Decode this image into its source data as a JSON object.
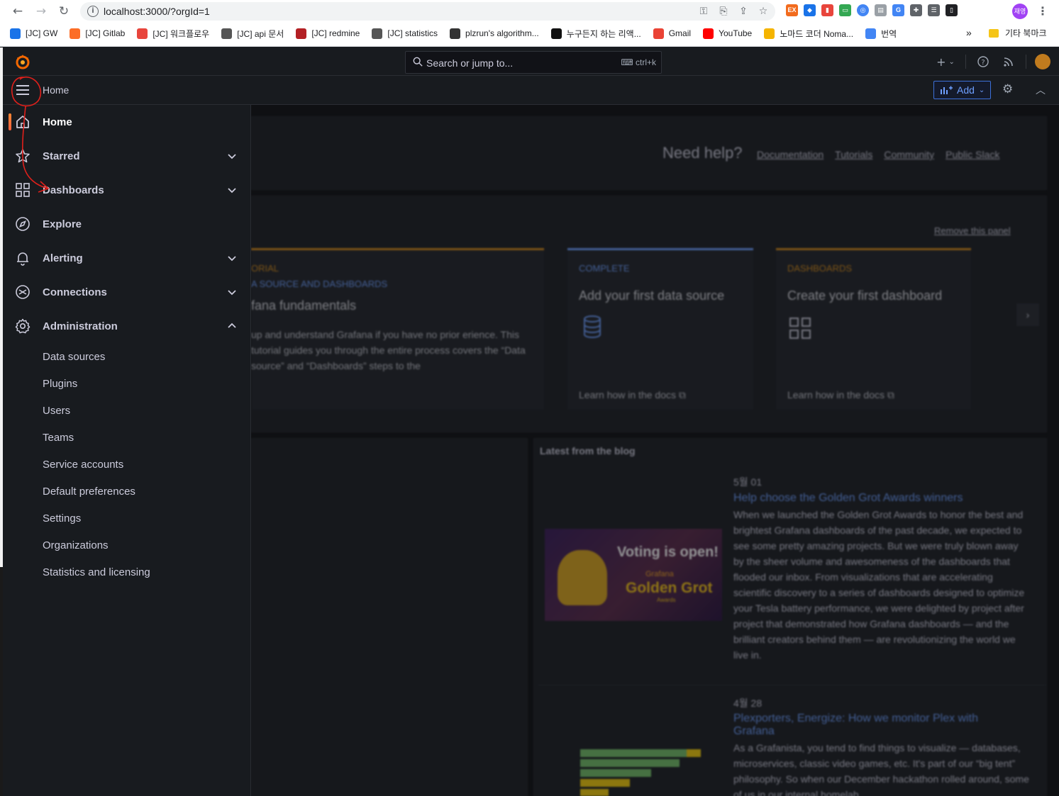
{
  "browser": {
    "url": "localhost:3000/?orgId=1",
    "profile_label": "재영",
    "bookmarks": [
      {
        "label": "[JC] GW",
        "color": "#1a73e8"
      },
      {
        "label": "[JC] Gitlab",
        "color": "#fc6d26"
      },
      {
        "label": "[JC] 워크플로우",
        "color": "#e8453c"
      },
      {
        "label": "[JC] api 문서",
        "color": "#555555"
      },
      {
        "label": "[JC] redmine",
        "color": "#b32024"
      },
      {
        "label": "[JC] statistics",
        "color": "#555555"
      },
      {
        "label": "plzrun's algorithm...",
        "color": "#333333"
      },
      {
        "label": "누구든지 하는 리액...",
        "color": "#111111"
      },
      {
        "label": "Gmail",
        "color": "#ea4335"
      },
      {
        "label": "YouTube",
        "color": "#ff0000"
      },
      {
        "label": "노마드 코더 Noma...",
        "color": "#f5b400"
      },
      {
        "label": "번역",
        "color": "#4285f4"
      }
    ],
    "bookmarks_more": "»",
    "other_bookmarks": "기타 북마크"
  },
  "topbar": {
    "search_placeholder": "Search or jump to...",
    "search_shortcut": "ctrl+k",
    "plus_label": "+",
    "help_icon": "help-icon",
    "news_icon": "rss-icon"
  },
  "subbar": {
    "breadcrumb": "Home",
    "add_label": "Add"
  },
  "sidenav": {
    "items": [
      {
        "label": "Home",
        "icon": "home-icon",
        "active": true
      },
      {
        "label": "Starred",
        "icon": "star-icon",
        "expandable": true
      },
      {
        "label": "Dashboards",
        "icon": "apps-icon",
        "expandable": true
      },
      {
        "label": "Explore",
        "icon": "compass-icon"
      },
      {
        "label": "Alerting",
        "icon": "bell-icon",
        "expandable": true
      },
      {
        "label": "Connections",
        "icon": "connections-icon",
        "expandable": true
      },
      {
        "label": "Administration",
        "icon": "cog-icon",
        "expanded": true
      }
    ],
    "admin_children": [
      "Data sources",
      "Plugins",
      "Users",
      "Teams",
      "Service accounts",
      "Default preferences",
      "Settings",
      "Organizations",
      "Statistics and licensing"
    ]
  },
  "dashboard": {
    "help_title": "Need help?",
    "help_links": [
      "Documentation",
      "Tutorials",
      "Community",
      "Public Slack"
    ],
    "remove_panel": "Remove this panel",
    "cards": [
      {
        "tag": "ORIAL",
        "tag2": "A SOURCE AND DASHBOARDS",
        "title": "fana fundamentals",
        "desc": "up and understand Grafana if you have no prior erience. This tutorial guides you through the entire process covers the “Data source” and “Dashboards” steps to the",
        "tag_color": "#d48a1a"
      },
      {
        "tag": "COMPLETE",
        "title": "Add your first data source",
        "learn": "Learn how in the docs",
        "tag_color": "#6e9fff"
      },
      {
        "tag": "DASHBOARDS",
        "title": "Create your first dashboard",
        "learn": "Learn how in the docs",
        "tag_color": "#d48a1a"
      }
    ],
    "next_arrow": "›",
    "blog_heading": "Latest from the blog",
    "blog_posts": [
      {
        "date": "5월 01",
        "title": "Help choose the Golden Grot Awards winners",
        "body": "When we launched the Golden Grot Awards to honor the best and brightest Grafana dashboards of the past decade, we expected to see some pretty amazing projects. But we were truly blown away by the sheer volume and awesomeness of the dashboards that flooded our inbox. From visualizations that are accelerating scientific discovery to a series of dashboards designed to optimize your Tesla battery performance, we were delighted by project after project that demonstrated how Grafana dashboards — and the brilliant creators behind them — are revolutionizing the world we live in."
      },
      {
        "date": "4월 28",
        "title": "Plexporters, Energize: How we monitor Plex with Grafana",
        "body": "As a Grafanista, you tend to find things to visualize — databases, microservices, classic video games, etc. It's part of our “big tent” philosophy. So when our December hackathon rolled around, some of us in our internal homelab"
      }
    ],
    "voting": {
      "headline": "Voting is open!",
      "brand": "Grafana",
      "award": "Golden Grot",
      "award_sub": "Awards"
    }
  },
  "colors": {
    "bg": "#181b1f",
    "accent_orange": "#ff8833",
    "link_blue": "#6e9fff",
    "annotation_red": "#e0201b"
  }
}
